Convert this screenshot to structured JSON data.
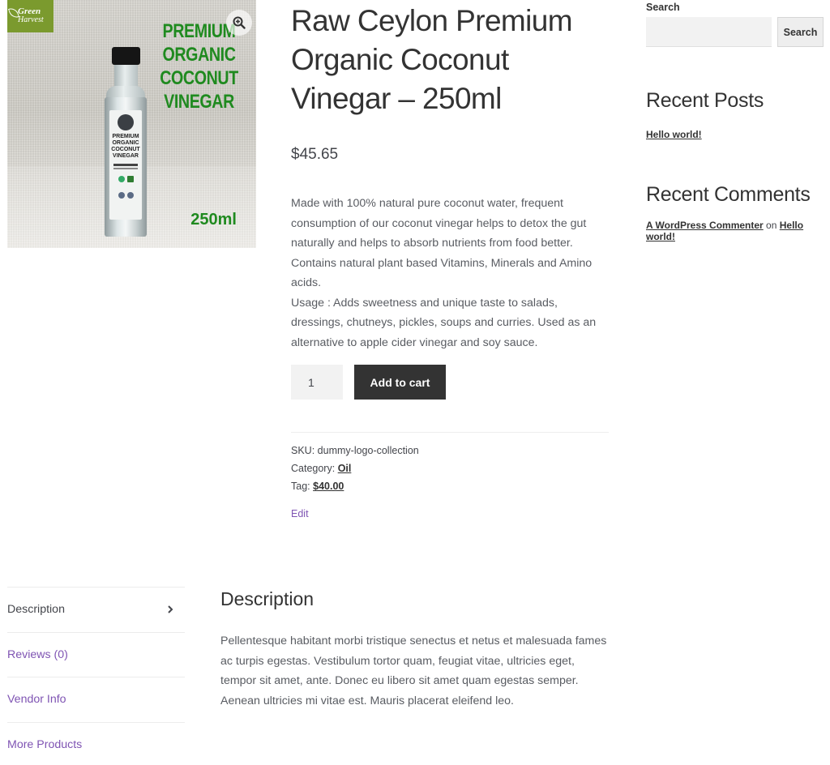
{
  "product": {
    "image": {
      "brand_logo_line1": "Green",
      "brand_logo_line2": "Harvest",
      "pack_title": [
        "PREMIUM",
        "ORGANIC",
        "COCONUT",
        "VINEGAR"
      ],
      "pack_size": "250ml",
      "bottle_label": [
        "PREMIUM",
        "ORGANIC",
        "COCONUT",
        "VINEGAR"
      ],
      "zoom_icon": "zoom-in-icon"
    },
    "title": "Raw Ceylon Premium Organic Coconut Vinegar – 250ml",
    "price": "$45.65",
    "short_description": [
      "Made with 100% natural pure coconut water, frequent consumption of our coconut vinegar helps to detox the gut naturally and helps to absorb nutrients from food better. Contains natural plant based Vitamins, Minerals and Amino acids.",
      "Usage : Adds sweetness and unique taste to salads, dressings, chutneys, pickles, soups and curries. Used as an alternative to apple cider vinegar and soy sauce."
    ],
    "quantity": "1",
    "add_to_cart_label": "Add to cart",
    "meta": {
      "sku_label": "SKU:",
      "sku_value": "dummy-logo-collection",
      "category_label": "Category:",
      "category_value": "Oil",
      "tag_label": "Tag:",
      "tag_value": "$40.00"
    },
    "edit_label": "Edit"
  },
  "sidebar": {
    "search_label": "Search",
    "search_value": "",
    "search_button_label": "Search",
    "recent_posts_title": "Recent Posts",
    "recent_posts": [
      "Hello world!"
    ],
    "recent_comments_title": "Recent Comments",
    "recent_comment": {
      "author": "A WordPress Commenter",
      "on_word": "on",
      "post": "Hello world!"
    }
  },
  "tabs": {
    "items": [
      {
        "label": "Description",
        "active": true
      },
      {
        "label": "Reviews (0)",
        "active": false
      },
      {
        "label": "Vendor Info",
        "active": false
      },
      {
        "label": "More Products",
        "active": false
      }
    ],
    "panel_heading": "Description",
    "panel_body": "Pellentesque habitant morbi tristique senectus et netus et malesuada fames ac turpis egestas. Vestibulum tortor quam, feugiat vitae, ultricies eget, tempor sit amet, ante. Donec eu libero sit amet quam egestas semper. Aenean ultricies mi vitae est. Mauris placerat eleifend leo."
  },
  "colors": {
    "accent_purple": "#7f54b3",
    "button_dark": "#333333",
    "pack_green": "#1f8a1f",
    "logo_green": "#7b9a2e"
  }
}
